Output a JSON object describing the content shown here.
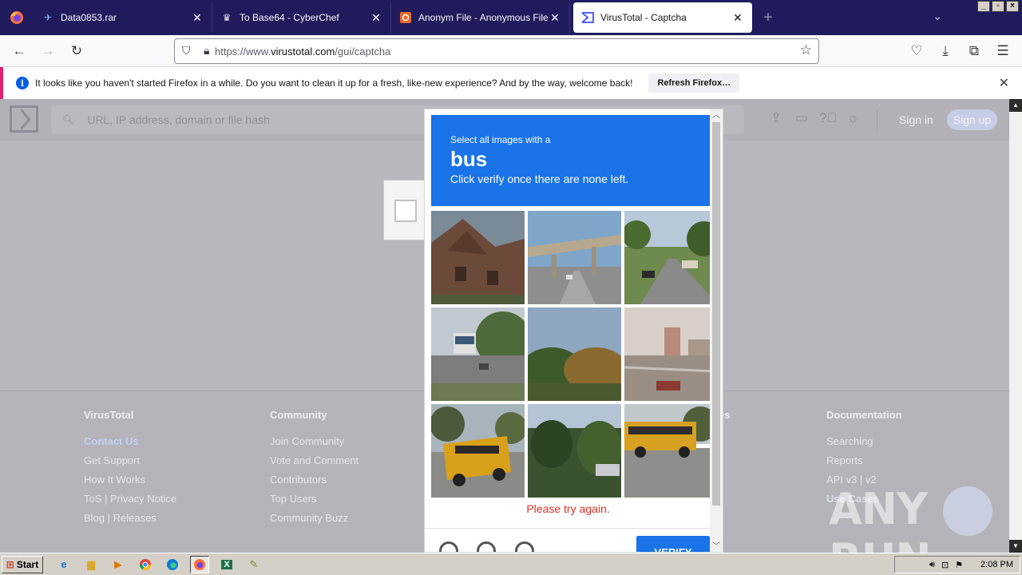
{
  "browser": {
    "tabs": [
      {
        "title": "Data0853.rar",
        "active": false
      },
      {
        "title": "To Base64 - CyberChef",
        "active": false
      },
      {
        "title": "Anonym File - Anonymous File Uplo",
        "active": false
      },
      {
        "title": "VirusTotal - Captcha",
        "active": true
      }
    ],
    "url_prefix": "https://www.",
    "url_domain": "virustotal.com",
    "url_path": "/gui/captcha"
  },
  "notification": {
    "message": "It looks like you haven't started Firefox in a while. Do you want to clean it up for a fresh, like-new experience? And by the way, welcome back!",
    "button_label": "Refresh Firefox…"
  },
  "vt": {
    "search_placeholder": "URL, IP address, domain or file hash",
    "signin_label": "Sign in",
    "signup_label": "Sign up"
  },
  "captcha": {
    "line1": "Select all images with a",
    "target": "bus",
    "line3": "Click verify once there are none left.",
    "error": "Please try again.",
    "verify_label": "VERIFY"
  },
  "footer": {
    "columns": [
      {
        "title": "VirusTotal",
        "links": [
          "Contact Us",
          "Get Support",
          "How It Works",
          "ToS | Privacy Notice",
          "Blog | Releases"
        ]
      },
      {
        "title": "Community",
        "links": [
          "Join Community",
          "Vote and Comment",
          "Contributors",
          "Top Users",
          "Community Buzz"
        ]
      },
      {
        "title": "es",
        "links": []
      },
      {
        "title": "Documentation",
        "links": [
          "Searching",
          "Reports",
          "API v3 | v2",
          "Use Cases"
        ]
      }
    ]
  },
  "watermark": "ANY RUN",
  "taskbar": {
    "start_label": "Start",
    "clock": "2:08 PM"
  },
  "colors": {
    "tabbar_bg": "#1f1b5c",
    "captcha_blue": "#1a73e8",
    "error_red": "#d93025"
  }
}
